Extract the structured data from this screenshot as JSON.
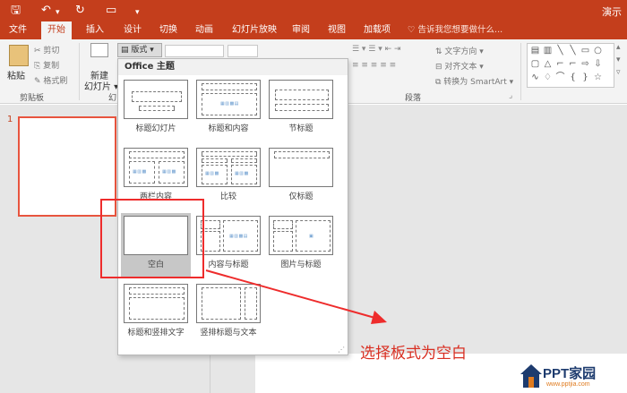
{
  "app": {
    "window_title": "演示"
  },
  "tabs": [
    {
      "label": "文件"
    },
    {
      "label": "开始"
    },
    {
      "label": "插入"
    },
    {
      "label": "设计"
    },
    {
      "label": "切换"
    },
    {
      "label": "动画"
    },
    {
      "label": "幻灯片放映"
    },
    {
      "label": "审阅"
    },
    {
      "label": "视图"
    },
    {
      "label": "加载项"
    }
  ],
  "search": {
    "placeholder": "告诉我您想要做什么..."
  },
  "ribbon": {
    "paste_label": "粘贴",
    "cut_label": "剪切",
    "copy_label": "复制",
    "format_painter_label": "格式刷",
    "clipboard_group": "剪贴板",
    "new_slide_line1": "新建",
    "new_slide_line2": "幻灯片",
    "slides_group_fragment": "幻",
    "layout_button": "版式",
    "text_direction_label": "文字方向",
    "align_text_label": "对齐文本",
    "smartart_label": "转换为 SmartArt",
    "paragraph_group": "段落"
  },
  "slide_panel": {
    "slide_number": "1"
  },
  "layout_dropdown": {
    "header": "Office 主题",
    "layouts": [
      {
        "name": "标题幻灯片"
      },
      {
        "name": "标题和内容"
      },
      {
        "name": "节标题"
      },
      {
        "name": "两栏内容"
      },
      {
        "name": "比较"
      },
      {
        "name": "仅标题"
      },
      {
        "name": "空白",
        "selected": true
      },
      {
        "name": "内容与标题"
      },
      {
        "name": "图片与标题"
      },
      {
        "name": "标题和竖排文字"
      },
      {
        "name": "竖排标题与文本"
      }
    ]
  },
  "annotation": {
    "text": "选择板式为空白",
    "color": "#d92f22"
  },
  "watermark": {
    "brand": "PPT家园",
    "url": "www.pptjia.com"
  },
  "colors": {
    "accent": "#c43e1c",
    "highlight": "#ee2c2c"
  }
}
